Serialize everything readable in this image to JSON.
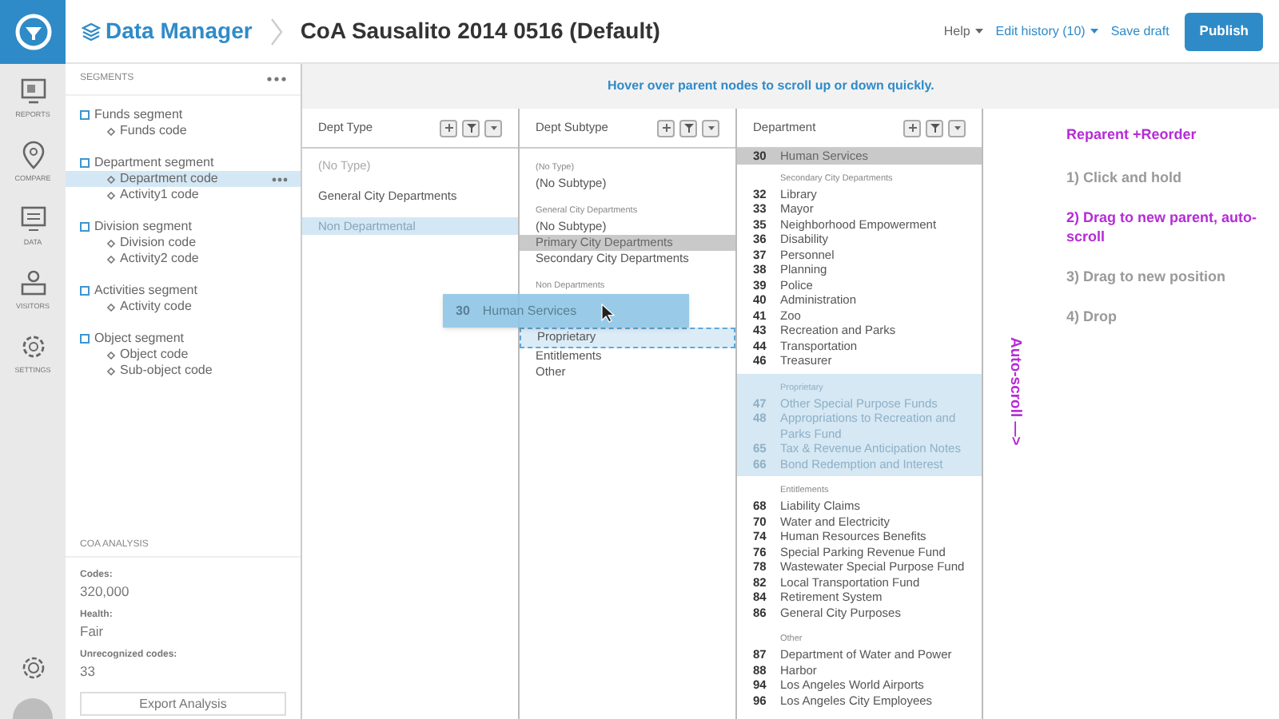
{
  "app": {
    "title": "Data Manager"
  },
  "document_title": "CoA Sausalito 2014 0516 (Default)",
  "header_actions": [
    {
      "kind": "menu",
      "label": "Help"
    },
    {
      "kind": "link-menu",
      "label": "Edit history (10)"
    },
    {
      "kind": "link",
      "label": "Save draft"
    },
    {
      "kind": "primary",
      "label": "Publish"
    }
  ],
  "nav": [
    {
      "kind": "reports",
      "label": "REPORTS"
    },
    {
      "kind": "compare",
      "label": "COMPARE"
    },
    {
      "kind": "data",
      "label": "DATA"
    },
    {
      "kind": "visitors",
      "label": "VISITORS"
    },
    {
      "kind": "settings",
      "label": "SETTINGS"
    }
  ],
  "segments": {
    "title": "SEGMENTS",
    "items": [
      {
        "label": "Funds segment",
        "children": [
          {
            "label": "Funds code",
            "selected": false
          }
        ]
      },
      {
        "label": "Department segment",
        "children": [
          {
            "label": "Department code",
            "selected": true
          },
          {
            "label": "Activity1 code",
            "selected": false
          }
        ]
      },
      {
        "label": "Division segment",
        "children": [
          {
            "label": "Division code",
            "selected": false
          },
          {
            "label": "Activity2 code",
            "selected": false
          }
        ]
      },
      {
        "label": "Activities segment",
        "children": [
          {
            "label": "Activity code",
            "selected": false
          }
        ]
      },
      {
        "label": "Object segment",
        "children": [
          {
            "label": "Object code",
            "selected": false
          },
          {
            "label": "Sub-object code",
            "selected": false
          }
        ]
      }
    ]
  },
  "analysis": {
    "title": "COA ANALYSIS",
    "stats": [
      {
        "label": "Codes:",
        "value": "320,000"
      },
      {
        "label": "Health:",
        "value": "Fair"
      },
      {
        "label": "Unrecognized codes:",
        "value": "33"
      }
    ],
    "button": "Export Analysis"
  },
  "hint": "Hover over parent nodes to scroll up or down quickly.",
  "columns": [
    {
      "kind": "type",
      "title": "Dept Type",
      "groups": [
        {
          "items": [
            {
              "text": "(No Type)",
              "selected": false,
              "hovered": false,
              "muted": true
            },
            {
              "text": "General City Departments",
              "selected": false,
              "hovered": false,
              "muted": false
            },
            {
              "text": "Non Departmental",
              "selected": true,
              "hovered": false,
              "muted": false
            }
          ]
        }
      ]
    },
    {
      "kind": "subtype",
      "title": "Dept Subtype",
      "groups": [
        {
          "label": "(No Type)",
          "items": [
            {
              "text": "(No Subtype)",
              "selected": false,
              "hovered": false,
              "drop_target": false
            }
          ]
        },
        {
          "label": "General City Departments",
          "items": [
            {
              "text": "(No Subtype)",
              "selected": false,
              "hovered": false,
              "drop_target": false
            },
            {
              "text": "Primary City Departments",
              "selected": false,
              "hovered": true,
              "drop_target": false
            },
            {
              "text": "Secondary City Departments",
              "selected": false,
              "hovered": false,
              "drop_target": false
            }
          ]
        },
        {
          "label": "Non Departments",
          "items": [
            {
              "text": "Proprietary",
              "selected": false,
              "hovered": false,
              "drop_target": true
            },
            {
              "text": "Entitlements",
              "selected": false,
              "hovered": false,
              "drop_target": false
            },
            {
              "text": "Other",
              "selected": false,
              "hovered": false,
              "drop_target": false
            }
          ]
        }
      ]
    },
    {
      "kind": "department",
      "title": "Department",
      "groups": [
        {
          "highlighted": false,
          "items": [
            {
              "number": "30",
              "text": "Human Services",
              "selected": false,
              "hovered": true
            }
          ]
        },
        {
          "label": "Secondary City Departments",
          "highlighted": false,
          "items": [
            {
              "number": "32",
              "text": "Library",
              "selected": false,
              "hovered": false
            },
            {
              "number": "33",
              "text": "Mayor",
              "selected": false,
              "hovered": false
            },
            {
              "number": "35",
              "text": "Neighborhood Empowerment",
              "selected": false,
              "hovered": false
            },
            {
              "number": "36",
              "text": "Disability",
              "selected": false,
              "hovered": false
            },
            {
              "number": "37",
              "text": "Personnel",
              "selected": false,
              "hovered": false
            },
            {
              "number": "38",
              "text": "Planning",
              "selected": false,
              "hovered": false
            },
            {
              "number": "39",
              "text": "Police",
              "selected": false,
              "hovered": false
            },
            {
              "number": "40",
              "text": "Administration",
              "selected": false,
              "hovered": false
            },
            {
              "number": "41",
              "text": "Zoo",
              "selected": false,
              "hovered": false
            },
            {
              "number": "43",
              "text": "Recreation and Parks",
              "selected": false,
              "hovered": false
            },
            {
              "number": "44",
              "text": "Transportation",
              "selected": false,
              "hovered": false
            },
            {
              "number": "46",
              "text": "Treasurer",
              "selected": false,
              "hovered": false
            }
          ]
        },
        {
          "label": "Proprietary",
          "highlighted": true,
          "items": [
            {
              "number": "47",
              "text": "Other Special Purpose Funds",
              "selected": false,
              "hovered": false
            },
            {
              "number": "48",
              "text": "Appropriations to Recreation and Parks Fund",
              "selected": false,
              "hovered": false
            },
            {
              "number": "65",
              "text": "Tax & Revenue Anticipation Notes",
              "selected": false,
              "hovered": false
            },
            {
              "number": "66",
              "text": "Bond Redemption and Interest",
              "selected": false,
              "hovered": false
            }
          ]
        },
        {
          "label": "Entitlements",
          "highlighted": false,
          "items": [
            {
              "number": "68",
              "text": "Liability Claims",
              "selected": false,
              "hovered": false
            },
            {
              "number": "70",
              "text": "Water and Electricity",
              "selected": false,
              "hovered": false
            },
            {
              "number": "74",
              "text": "Human Resources Benefits",
              "selected": false,
              "hovered": false
            },
            {
              "number": "76",
              "text": "Special Parking Revenue Fund",
              "selected": false,
              "hovered": false
            },
            {
              "number": "78",
              "text": "Wastewater Special Purpose Fund",
              "selected": false,
              "hovered": false
            },
            {
              "number": "82",
              "text": "Local Transportation Fund",
              "selected": false,
              "hovered": false
            },
            {
              "number": "84",
              "text": "Retirement System",
              "selected": false,
              "hovered": false
            },
            {
              "number": "86",
              "text": "General City Purposes",
              "selected": false,
              "hovered": false
            }
          ]
        },
        {
          "label": "Other",
          "highlighted": false,
          "items": [
            {
              "number": "87",
              "text": "Department of Water and Power",
              "selected": false,
              "hovered": false
            },
            {
              "number": "88",
              "text": "Harbor",
              "selected": false,
              "hovered": false
            },
            {
              "number": "94",
              "text": "Los Angeles World Airports",
              "selected": false,
              "hovered": false
            },
            {
              "number": "96",
              "text": "Los Angeles City Employees",
              "selected": false,
              "hovered": false
            }
          ]
        }
      ]
    }
  ],
  "drag_item": {
    "number": "30",
    "text": "Human Services"
  },
  "annotation": {
    "title": "Reparent +Reorder",
    "steps": [
      {
        "text": "1) Click and hold",
        "active": false
      },
      {
        "text": "2) Drag to new parent, auto-scroll",
        "active": true
      },
      {
        "text": "3) Drag to new position",
        "active": false
      },
      {
        "text": "4) Drop",
        "active": false
      }
    ],
    "side_note": "Auto-scroll —>"
  }
}
